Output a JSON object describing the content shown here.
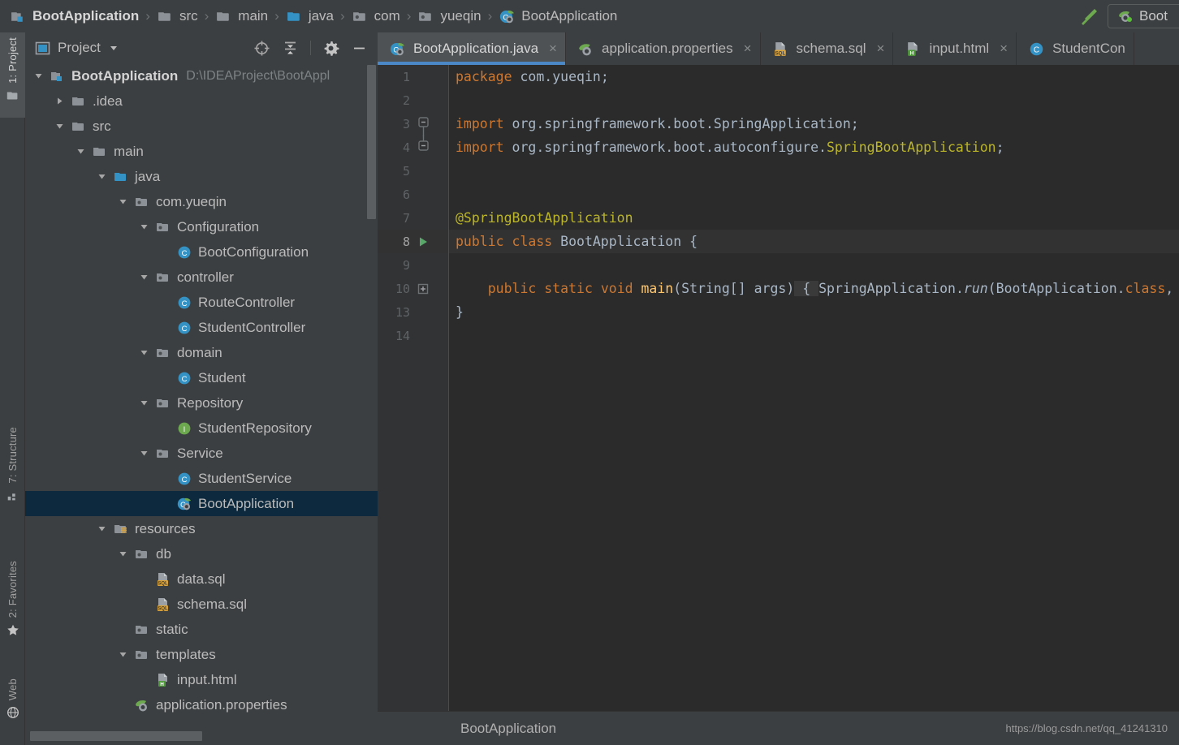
{
  "breadcrumb": {
    "items": [
      {
        "label": "BootApplication",
        "icon": "module-icon"
      },
      {
        "label": "src",
        "icon": "folder-icon"
      },
      {
        "label": "main",
        "icon": "folder-icon"
      },
      {
        "label": "java",
        "icon": "source-folder-icon"
      },
      {
        "label": "com",
        "icon": "package-icon"
      },
      {
        "label": "yueqin",
        "icon": "package-icon"
      },
      {
        "label": "BootApplication",
        "icon": "spring-class-icon"
      }
    ],
    "separator": "›"
  },
  "toolbar": {
    "build_icon": "hammer-icon",
    "run_config_label": "Boot",
    "run_config_icon": "spring-bean-icon"
  },
  "tool_window_strip": {
    "items": [
      {
        "label": "1: Project",
        "icon": "project-folder-icon",
        "active": true
      },
      {
        "label": "7: Structure",
        "icon": "structure-icon",
        "active": false
      },
      {
        "label": "2: Favorites",
        "icon": "star-icon",
        "active": false
      },
      {
        "label": "Web",
        "icon": "web-icon",
        "active": false
      }
    ]
  },
  "project_panel": {
    "title": "Project",
    "dropdown_icon": "chevron-down-icon",
    "view_icon": "project-view-icon",
    "actions": [
      {
        "name": "scroll-from-source",
        "icon": "target-icon"
      },
      {
        "name": "collapse-all",
        "icon": "collapse-all-icon"
      },
      {
        "name": "settings",
        "icon": "gear-icon"
      },
      {
        "name": "hide",
        "icon": "minimize-icon"
      }
    ],
    "tree": [
      {
        "label": "BootApplication",
        "path": "D:\\IDEAProject\\BootAppl",
        "indent": 0,
        "twisty": "down",
        "icon": "module-icon",
        "bold": true,
        "selected": false
      },
      {
        "label": ".idea",
        "indent": 1,
        "twisty": "right",
        "icon": "folder-icon",
        "selected": false
      },
      {
        "label": "src",
        "indent": 1,
        "twisty": "down",
        "icon": "folder-icon",
        "selected": false
      },
      {
        "label": "main",
        "indent": 2,
        "twisty": "down",
        "icon": "folder-icon",
        "selected": false
      },
      {
        "label": "java",
        "indent": 3,
        "twisty": "down",
        "icon": "source-folder-icon",
        "selected": false
      },
      {
        "label": "com.yueqin",
        "indent": 4,
        "twisty": "down",
        "icon": "package-icon",
        "selected": false
      },
      {
        "label": "Configuration",
        "indent": 5,
        "twisty": "down",
        "icon": "package-icon",
        "selected": false
      },
      {
        "label": "BootConfiguration",
        "indent": 6,
        "twisty": "none",
        "icon": "class-icon",
        "selected": false
      },
      {
        "label": "controller",
        "indent": 5,
        "twisty": "down",
        "icon": "package-icon",
        "selected": false
      },
      {
        "label": "RouteController",
        "indent": 6,
        "twisty": "none",
        "icon": "class-icon",
        "selected": false
      },
      {
        "label": "StudentController",
        "indent": 6,
        "twisty": "none",
        "icon": "class-icon",
        "selected": false
      },
      {
        "label": "domain",
        "indent": 5,
        "twisty": "down",
        "icon": "package-icon",
        "selected": false
      },
      {
        "label": "Student",
        "indent": 6,
        "twisty": "none",
        "icon": "class-icon",
        "selected": false
      },
      {
        "label": "Repository",
        "indent": 5,
        "twisty": "down",
        "icon": "package-icon",
        "selected": false
      },
      {
        "label": "StudentRepository",
        "indent": 6,
        "twisty": "none",
        "icon": "interface-icon",
        "selected": false
      },
      {
        "label": "Service",
        "indent": 5,
        "twisty": "down",
        "icon": "package-icon",
        "selected": false
      },
      {
        "label": "StudentService",
        "indent": 6,
        "twisty": "none",
        "icon": "class-icon",
        "selected": false
      },
      {
        "label": "BootApplication",
        "indent": 6,
        "twisty": "none",
        "icon": "spring-class-icon",
        "selected": true
      },
      {
        "label": "resources",
        "indent": 3,
        "twisty": "down",
        "icon": "resource-folder-icon",
        "selected": false
      },
      {
        "label": "db",
        "indent": 4,
        "twisty": "down",
        "icon": "package-icon",
        "selected": false
      },
      {
        "label": "data.sql",
        "indent": 5,
        "twisty": "none",
        "icon": "sql-file-icon",
        "selected": false
      },
      {
        "label": "schema.sql",
        "indent": 5,
        "twisty": "none",
        "icon": "sql-file-icon",
        "selected": false
      },
      {
        "label": "static",
        "indent": 4,
        "twisty": "none",
        "icon": "package-icon",
        "selected": false
      },
      {
        "label": "templates",
        "indent": 4,
        "twisty": "down",
        "icon": "package-icon",
        "selected": false
      },
      {
        "label": "input.html",
        "indent": 5,
        "twisty": "none",
        "icon": "html-file-icon",
        "selected": false
      },
      {
        "label": "application.properties",
        "indent": 4,
        "twisty": "none",
        "icon": "spring-bean-icon",
        "selected": false
      }
    ]
  },
  "editor": {
    "tabs": [
      {
        "label": "BootApplication.java",
        "icon": "spring-class-icon",
        "active": true,
        "closable": true
      },
      {
        "label": "application.properties",
        "icon": "spring-bean-icon",
        "active": false,
        "closable": true
      },
      {
        "label": "schema.sql",
        "icon": "sql-file-icon",
        "active": false,
        "closable": true
      },
      {
        "label": "input.html",
        "icon": "html-file-icon",
        "active": false,
        "closable": true
      },
      {
        "label": "StudentCon",
        "icon": "class-icon",
        "active": false,
        "closable": false
      }
    ],
    "close_glyph": "×",
    "lines": [
      {
        "num": "1",
        "current": false,
        "gutter": "none",
        "fold": "none"
      },
      {
        "num": "2",
        "current": false,
        "gutter": "none",
        "fold": "none"
      },
      {
        "num": "3",
        "current": false,
        "gutter": "none",
        "fold": "collapse-top"
      },
      {
        "num": "4",
        "current": false,
        "gutter": "none",
        "fold": "collapse-bottom"
      },
      {
        "num": "5",
        "current": false,
        "gutter": "none",
        "fold": "none"
      },
      {
        "num": "6",
        "current": false,
        "gutter": "none",
        "fold": "none"
      },
      {
        "num": "7",
        "current": false,
        "gutter": "none",
        "fold": "none"
      },
      {
        "num": "8",
        "current": true,
        "gutter": "run-icon",
        "fold": "none"
      },
      {
        "num": "9",
        "current": false,
        "gutter": "none",
        "fold": "none"
      },
      {
        "num": "10",
        "current": false,
        "gutter": "none",
        "fold": "expand"
      },
      {
        "num": "13",
        "current": false,
        "gutter": "none",
        "fold": "none"
      },
      {
        "num": "14",
        "current": false,
        "gutter": "none",
        "fold": "none"
      }
    ],
    "code": {
      "l1_kw": "package",
      "l1_rest": " com.yueqin;",
      "l3_kw": "import",
      "l3_rest": " org.springframework.boot.SpringApplication;",
      "l4_kw": "import",
      "l4_mid": " org.springframework.boot.autoconfigure.",
      "l4_cls": "SpringBootApplication",
      "l4_end": ";",
      "l7_ann": "@SpringBootApplication",
      "l8_kw1": "public class ",
      "l8_name": "BootApplication {",
      "l10_kw": "public static void ",
      "l10_main": "main",
      "l10_sig": "(String[] args)",
      "l10_brace": " { ",
      "l10_call1": "SpringApplication.",
      "l10_run": "run",
      "l10_call2": "(BootApplication.",
      "l10_classkw": "class",
      "l10_args": ", args); ",
      "l10_closefold": "}",
      "l13": "}"
    }
  },
  "status_bar": {
    "left_text": "BootApplication",
    "watermark": "https://blog.csdn.net/qq_41241310"
  },
  "colors": {
    "accent_blue": "#4a88c7",
    "selection_navy": "#0d293e",
    "keyword_orange": "#cc7832",
    "annotation_yellow": "#bbb529",
    "editor_bg": "#2b2b2b",
    "panel_bg": "#3c3f41"
  }
}
